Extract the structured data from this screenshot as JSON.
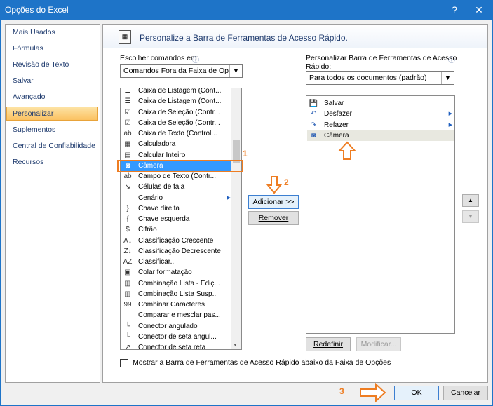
{
  "window": {
    "title": "Opções do Excel",
    "help_label": "?",
    "close_label": "✕"
  },
  "sidebar": {
    "items": [
      {
        "label": "Mais Usados"
      },
      {
        "label": "Fórmulas"
      },
      {
        "label": "Revisão de Texto"
      },
      {
        "label": "Salvar"
      },
      {
        "label": "Avançado"
      },
      {
        "label": "Personalizar",
        "selected": true
      },
      {
        "label": "Suplementos"
      },
      {
        "label": "Central de Confiabilidade"
      },
      {
        "label": "Recursos"
      }
    ]
  },
  "main": {
    "header": "Personalize a Barra de Ferramentas de Acesso Rápido.",
    "choose_label_pre": "",
    "choose_label": "Escolher comandos em:",
    "choose_value": "Comandos Fora da Faixa de Opç...",
    "customize_label_line1": "Personalizar Barra de Ferramentas de Acesso",
    "customize_label_line2": "Rápido:",
    "customize_value": "Para todos os documentos (padrão)",
    "info_icon": "ⓘ",
    "commands": [
      {
        "label": "Caixa de Listagem (Cont...",
        "icon": "list-box-icon",
        "glyph": "☰"
      },
      {
        "label": "Caixa de Listagem (Cont...",
        "icon": "list-box-icon",
        "glyph": "☰"
      },
      {
        "label": "Caixa de Seleção (Contr...",
        "icon": "checkbox-icon",
        "glyph": "☑"
      },
      {
        "label": "Caixa de Seleção (Contr...",
        "icon": "checkbox-icon",
        "glyph": "☑"
      },
      {
        "label": "Caixa de Texto (Control...",
        "icon": "text-box-icon",
        "glyph": "ab"
      },
      {
        "label": "Calculadora",
        "icon": "calculator-icon",
        "glyph": "▦"
      },
      {
        "label": "Calcular Inteiro",
        "icon": "calculate-icon",
        "glyph": "▤"
      },
      {
        "label": "Câmera",
        "icon": "camera-icon",
        "glyph": "◙",
        "selected": true
      },
      {
        "label": "Campo de Texto (Contr...",
        "icon": "text-field-icon",
        "glyph": "ab"
      },
      {
        "label": "Células de fala",
        "icon": "speak-cells-icon",
        "glyph": "↘"
      },
      {
        "label": "Cenário",
        "icon": "scenario-icon",
        "glyph": "",
        "submenu": true
      },
      {
        "label": "Chave direita",
        "icon": "right-brace-icon",
        "glyph": "}"
      },
      {
        "label": "Chave esquerda",
        "icon": "left-brace-icon",
        "glyph": "{"
      },
      {
        "label": "Cifrão",
        "icon": "dollar-icon",
        "glyph": "$"
      },
      {
        "label": "Classificação Crescente",
        "icon": "sort-ascending-icon",
        "glyph": "A↓"
      },
      {
        "label": "Classificação Decrescente",
        "icon": "sort-descending-icon",
        "glyph": "Z↓"
      },
      {
        "label": "Classificar...",
        "icon": "sort-icon",
        "glyph": "AZ"
      },
      {
        "label": "Colar formatação",
        "icon": "paste-format-icon",
        "glyph": "▣"
      },
      {
        "label": "Combinação Lista - Ediç...",
        "icon": "combo-list-icon",
        "glyph": "▥"
      },
      {
        "label": "Combinação Lista Susp...",
        "icon": "combo-dropdown-icon",
        "glyph": "▥"
      },
      {
        "label": "Combinar Caracteres",
        "icon": "combine-characters-icon",
        "glyph": "99"
      },
      {
        "label": "Comparar e mesclar pas...",
        "icon": "compare-merge-icon",
        "glyph": ""
      },
      {
        "label": "Conector angulado",
        "icon": "elbow-connector-icon",
        "glyph": "└"
      },
      {
        "label": "Conector de seta angul...",
        "icon": "elbow-arrow-connector-icon",
        "glyph": "└"
      },
      {
        "label": "Conector de seta reta",
        "icon": "straight-arrow-connector-icon",
        "glyph": "↗"
      }
    ],
    "qat_items": [
      {
        "label": "Salvar",
        "icon": "save-icon",
        "glyph": "💾"
      },
      {
        "label": "Desfazer",
        "icon": "undo-icon",
        "glyph": "↶",
        "submenu": true
      },
      {
        "label": "Refazer",
        "icon": "redo-icon",
        "glyph": "↷",
        "submenu": true
      },
      {
        "label": "Câmera",
        "icon": "camera-icon",
        "glyph": "◙",
        "selected": true
      }
    ],
    "add_button": "Adicionar >>",
    "remove_button": "Remover",
    "move_up": "▲",
    "move_down": "▼",
    "reset_button": "Redefinir",
    "modify_button": "Modificar...",
    "show_below_label": "Mostrar a Barra de Ferramentas de Acesso Rápido abaixo da Faixa de Opções",
    "show_below_checked": false
  },
  "footer": {
    "ok_label": "OK",
    "cancel_label": "Cancelar"
  },
  "annotations": {
    "step1": "1",
    "step2": "2",
    "step3": "3",
    "color": "#ee7d22"
  }
}
